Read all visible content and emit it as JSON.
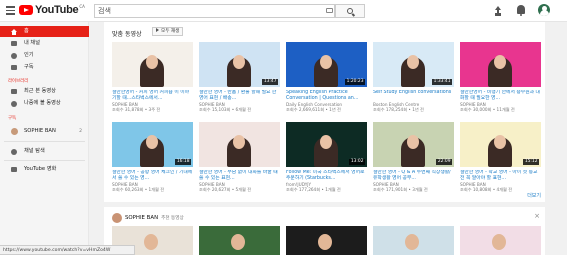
{
  "header": {
    "logo_text": "YouTube",
    "logo_region": "CA",
    "search_value": "검색",
    "icons": [
      "menu-icon",
      "search-icon",
      "keyboard-icon",
      "upload-icon",
      "bell-icon",
      "avatar"
    ]
  },
  "sidebar": {
    "items": [
      {
        "label": "홈",
        "icon": "home-icon",
        "active": true
      },
      {
        "label": "내 채널",
        "icon": "channel-icon"
      },
      {
        "label": "인기",
        "icon": "trending-icon"
      },
      {
        "label": "구독",
        "icon": "subscriptions-icon"
      }
    ],
    "library_title": "라이브러리",
    "library": [
      {
        "label": "최근 본 동영상",
        "icon": "history-icon"
      },
      {
        "label": "나중에 볼 동영상",
        "icon": "watch-later-icon"
      }
    ],
    "subs_title": "구독",
    "subs": [
      {
        "label": "SOPHIE BAN",
        "count": "2"
      }
    ],
    "extra": [
      {
        "label": "채널 탐색",
        "icon": "browse-channels-icon"
      },
      {
        "label": "YouTube 영화",
        "icon": "movies-icon"
      }
    ]
  },
  "recommended": {
    "title": "맞춤 동영상",
    "autoplay_label": "모두 재생",
    "more_label": "더보기",
    "videos": [
      {
        "title": "설만한영어 - 커피 영어 커피숍 이 이야기할 때...스타벅스에서...",
        "channel": "SOPHIE BAN",
        "meta": "조회수 31,878회 • 3주 전",
        "duration": "",
        "bg": "#f4f0ea"
      },
      {
        "title": "설만한 영어 - 반품 / 환불 할때 필요 한 영어 표현 / 배송...",
        "channel": "SOPHIE BAN",
        "meta": "조회수 15,103회 • 6개월 전",
        "duration": "13:47",
        "bg": "#cfe3f3"
      },
      {
        "title": "Speaking English Practice Conversation | Questions an...",
        "channel": "Daily English Conversation",
        "meta": "조회수 2,669,611회 • 1년 전",
        "duration": "1:20:23",
        "bg": "#1d5fc4"
      },
      {
        "title": "Self Study English conversations",
        "channel": "Boston English Centre",
        "meta": "조회수 178,254회 • 1년 전",
        "duration": "1:33:41",
        "bg": "#d8eaf6"
      },
      {
        "title": "설만한영어 - 비행기 안에서 승무원과 대화할 때 필요한 영...",
        "channel": "SOPHIE BAN",
        "meta": "조회수 30,000회 • 11개월 전",
        "duration": "",
        "bg": "#e8358f"
      },
      {
        "title": "설만한 영어 - 공항 영어 체크인 / 기내에서 쓸 수 있는 영...",
        "channel": "SOPHIE BAN",
        "meta": "조회수 60,263회 • 1개월 전",
        "duration": "16:18",
        "bg": "#7fc6e8"
      },
      {
        "title": "설만한 영어 - 부담 없이 대화를 바꿀 때 쓸 수 있는 표현...",
        "channel": "SOPHIE BAN",
        "meta": "조회수 20,627회 • 5개월 전",
        "duration": "",
        "bg": "#f1e4e1"
      },
      {
        "title": "Follow Me: 미국 스타벅스에서 영어로 주문하기 (Starbucks...",
        "channel": "from!JUDYJY",
        "meta": "조회수 177,264회 • 1개월 전",
        "duration": "13:02",
        "bg": "#0d2b24"
      },
      {
        "title": "설만한 영어 - Q & A 두번째 직장생활/유학생활 영어 공부...",
        "channel": "SOPHIE BAN",
        "meta": "조회수 171,901회 • 3개월 전",
        "duration": "22:09",
        "bg": "#c8d3b2"
      },
      {
        "title": "설만한 영어 - 학교 영어 - 아이 첫 등교 전 꼭 알아야 할 표현...",
        "channel": "SOPHIE BAN",
        "meta": "조회수 10,808회 • 4개월 전",
        "duration": "15:12",
        "bg": "#f7f0c8"
      }
    ]
  },
  "channel_section": {
    "channel": "SOPHIE BAN",
    "subtitle": "추천 동영상",
    "close_label": "×",
    "thumbs": [
      "#e9e2d8",
      "#3a6b3a",
      "#1c1c1c",
      "#cfe0e8",
      "#f2dde6"
    ]
  },
  "status_url": "https://www.youtube.com/watch?v=vHmZo4W"
}
